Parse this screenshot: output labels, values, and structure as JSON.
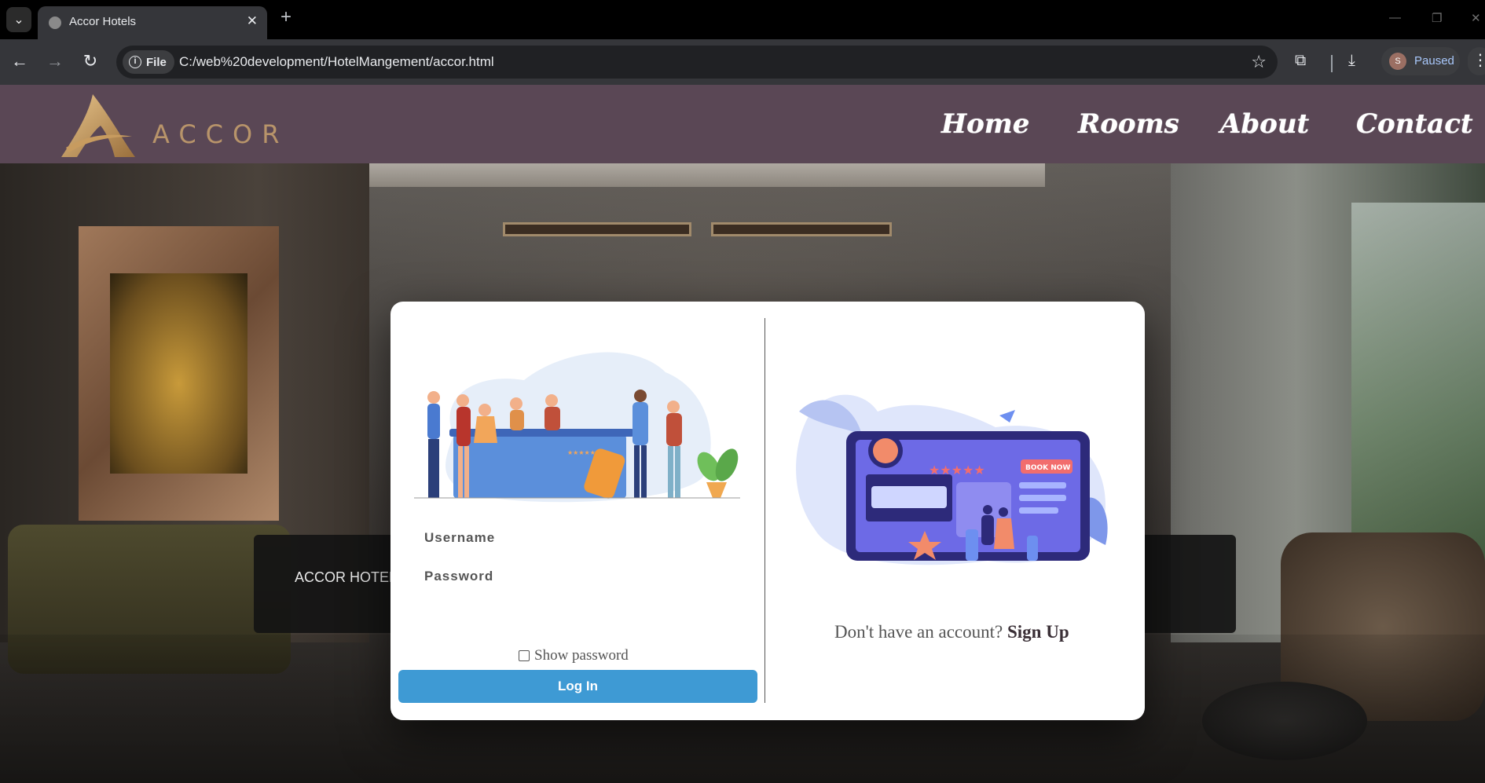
{
  "browser": {
    "tab_title": "Accor Hotels",
    "tab_close": "✕",
    "new_tab": "+",
    "file_chip": "File",
    "url": "C:/web%20development/HotelMangement/accor.html",
    "profile_initial": "S",
    "profile_status": "Paused",
    "icons": [
      "chevron-down-icon",
      "globe-icon",
      "close-icon",
      "plus-icon",
      "back-icon",
      "forward-icon",
      "reload-icon",
      "info-icon",
      "star-icon",
      "extensions-icon",
      "download-icon",
      "menu-icon"
    ]
  },
  "site": {
    "logo_text": "ACCOR",
    "nav": [
      {
        "label": "Home"
      },
      {
        "label": "Rooms"
      },
      {
        "label": "About"
      },
      {
        "label": "Contact"
      }
    ],
    "banner_text": "ACCOR HOTEL"
  },
  "login": {
    "username_label": "Username",
    "password_label": "Password",
    "show_password_label": "Show password",
    "login_button": "Log In",
    "signup_prompt": "Don't have an account?",
    "signup_link": "Sign Up",
    "booking_badge": "BOOK NOW",
    "rating_stars": "★★★★★"
  },
  "colors": {
    "header_bg": "#5a4755",
    "logo_gold": "#b8946a",
    "button_blue": "#3e9ad4",
    "modal_bg": "#ffffff"
  }
}
